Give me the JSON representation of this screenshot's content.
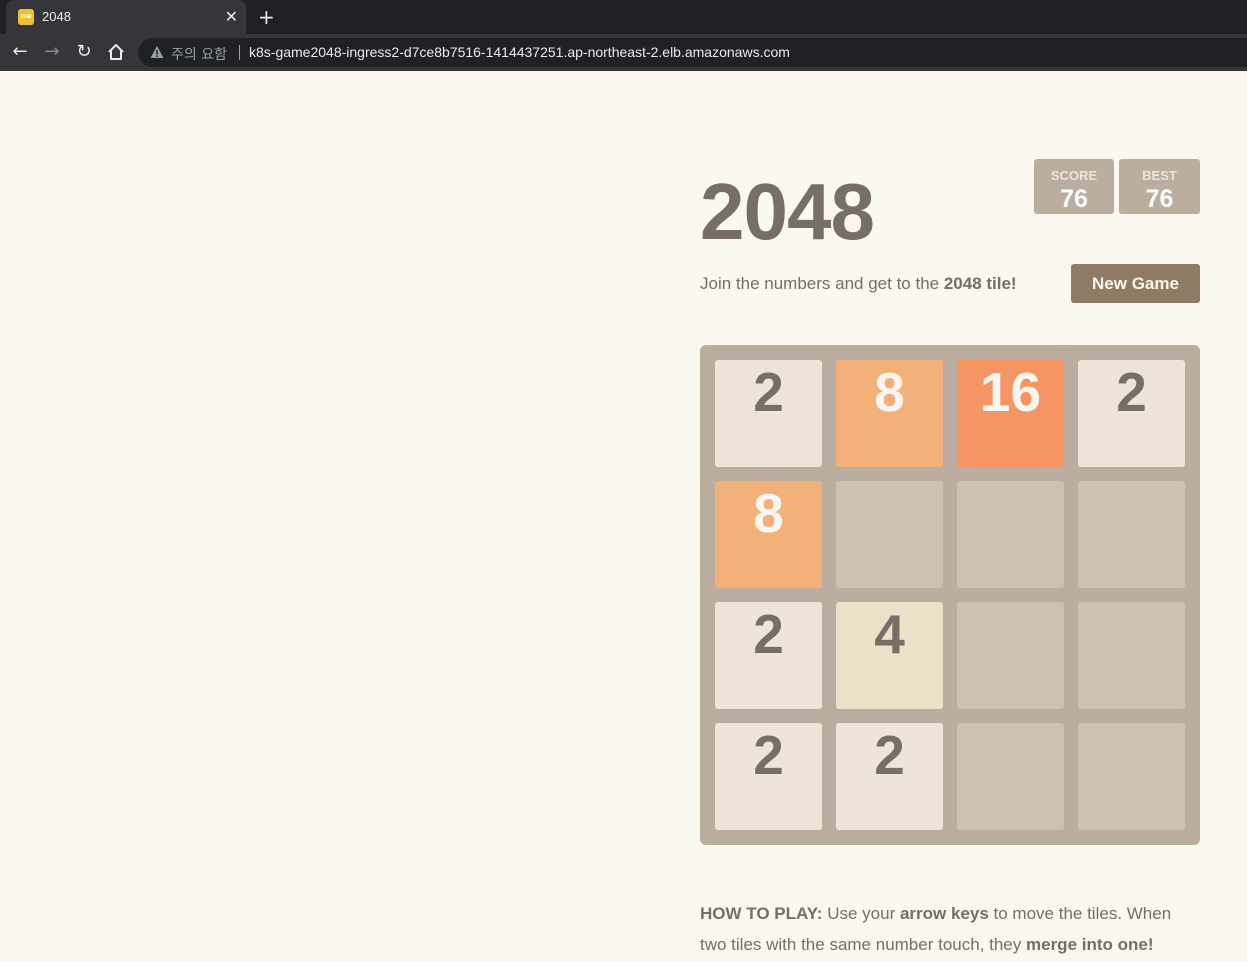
{
  "browser": {
    "tab": {
      "title": "2048",
      "favicon_text": "2048"
    },
    "new_tab_label": "+",
    "close_label": "✕",
    "security_warning": "주의 요함",
    "url": "k8s-game2048-ingress2-d7ce8b7516-1414437251.ap-northeast-2.elb.amazonaws.com"
  },
  "game": {
    "title": "2048",
    "score": {
      "label": "SCORE",
      "value": "76"
    },
    "best": {
      "label": "BEST",
      "value": "76"
    },
    "intro": {
      "prefix": "Join the numbers and get to the ",
      "highlight": "2048 tile!"
    },
    "new_game_label": "New Game",
    "board": [
      [
        "2",
        "8",
        "16",
        "2"
      ],
      [
        "8",
        "",
        "",
        ""
      ],
      [
        "2",
        "4",
        "",
        ""
      ],
      [
        "2",
        "2",
        "",
        ""
      ]
    ],
    "how_to_play": {
      "label": "HOW TO PLAY:",
      "text1": " Use your ",
      "keys": "arrow keys",
      "text2": " to move the tiles. When two tiles with the same number touch, they ",
      "merge": "merge into one!"
    },
    "colors": {
      "background": "#faf8ef",
      "board": "#bbada0",
      "empty_cell": "#cdc1b4",
      "tile_2": "#eee4da",
      "tile_4": "#ede0c8",
      "tile_8": "#f2b179",
      "tile_16": "#f59563",
      "dark_text": "#776e65",
      "light_text": "#f9f6f2",
      "button": "#8f7a66"
    }
  }
}
